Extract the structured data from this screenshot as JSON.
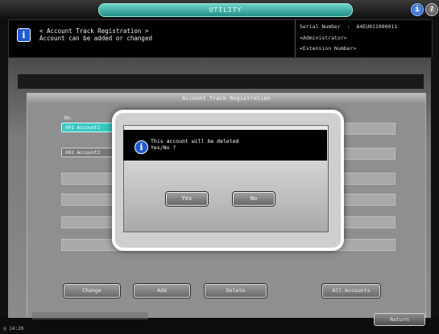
{
  "topbar": {
    "title": "UTILITY",
    "info_icon": "info-circle-icon",
    "help_icon": "help-icon",
    "help_label": "?"
  },
  "header": {
    "icon": "info-icon",
    "title_line1": "< Account Track Registration >",
    "title_line2": "Account can be added or changed",
    "serial_label": "Serial Number",
    "serial_value": "A4EU011000011",
    "admin": "<Administrator>",
    "extension": "<Extension Number>"
  },
  "panel": {
    "title": "Account Track Registration",
    "no_label": "No.",
    "accounts": [
      "001 Account1",
      "002 Account2"
    ],
    "buttons": {
      "change": "Change",
      "add": "Add",
      "delete": "Delete",
      "all_accounts": "All Accounts"
    }
  },
  "footer": {
    "return": "Return",
    "clock": "14:20"
  },
  "dialog": {
    "icon": "info-icon",
    "message_line1": "This account will be deleted",
    "message_line2": "Yes/No ?",
    "yes": "Yes",
    "no": "No"
  },
  "colors": {
    "accent_teal": "#37c9c0",
    "info_blue": "#1f5bd0",
    "header_bg": "#000000"
  }
}
